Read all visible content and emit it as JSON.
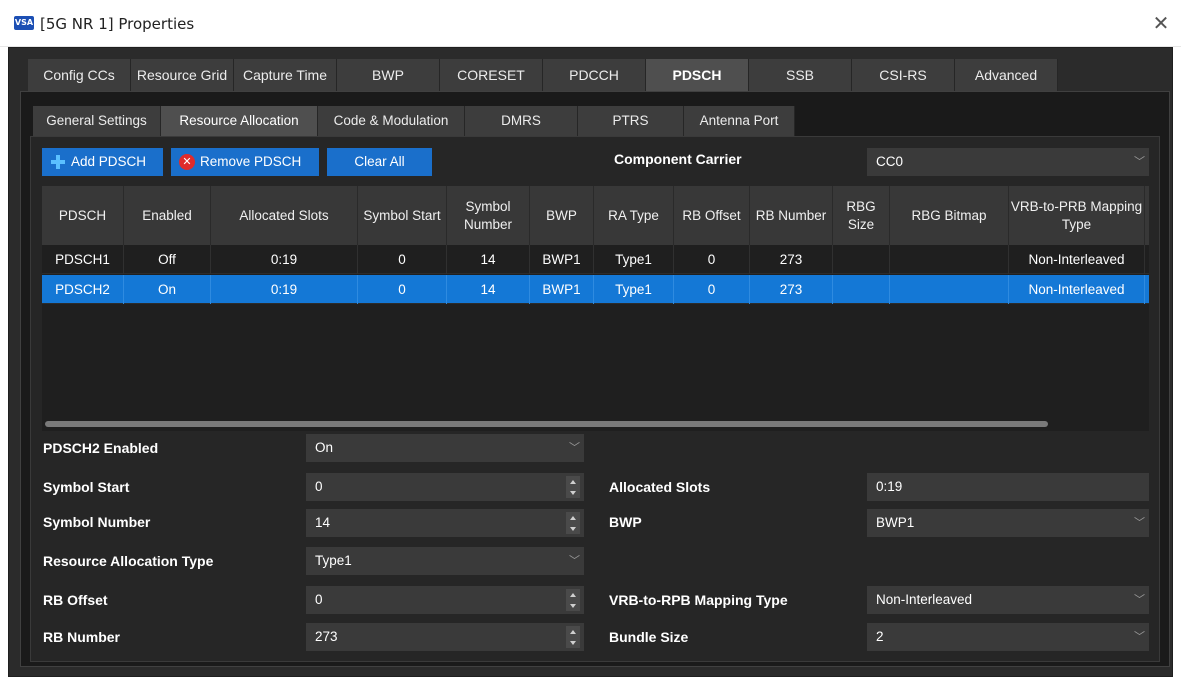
{
  "window": {
    "icon_text": "VSA",
    "title": "[5G NR 1] Properties",
    "close_glyph": "✕"
  },
  "tabs1": [
    {
      "label": "Config CCs"
    },
    {
      "label": "Resource Grid"
    },
    {
      "label": "Capture Time"
    },
    {
      "label": "BWP"
    },
    {
      "label": "CORESET"
    },
    {
      "label": "PDCCH"
    },
    {
      "label": "PDSCH"
    },
    {
      "label": "SSB"
    },
    {
      "label": "CSI-RS"
    },
    {
      "label": "Advanced"
    }
  ],
  "tabs2": [
    {
      "label": "General Settings"
    },
    {
      "label": "Resource Allocation"
    },
    {
      "label": "Code & Modulation"
    },
    {
      "label": "DMRS"
    },
    {
      "label": "PTRS"
    },
    {
      "label": "Antenna Port"
    }
  ],
  "toolbar": {
    "add_label": "Add PDSCH",
    "remove_label": "Remove PDSCH",
    "clear_label": "Clear All",
    "cc_label": "Component Carrier",
    "cc_value": "CC0"
  },
  "table": {
    "headers": [
      "PDSCH",
      "Enabled",
      "Allocated Slots",
      "Symbol Start",
      "Symbol Number",
      "BWP",
      "RA Type",
      "RB Offset",
      "RB Number",
      "RBG Size",
      "RBG Bitmap",
      "VRB-to-PRB Mapping Type"
    ],
    "rows": [
      {
        "cells": [
          "PDSCH1",
          "Off",
          "0:19",
          "0",
          "14",
          "BWP1",
          "Type1",
          "0",
          "273",
          "",
          "",
          "Non-Interleaved"
        ],
        "selected": false
      },
      {
        "cells": [
          "PDSCH2",
          "On",
          "0:19",
          "0",
          "14",
          "BWP1",
          "Type1",
          "0",
          "273",
          "",
          "",
          "Non-Interleaved"
        ],
        "selected": true
      }
    ]
  },
  "form_left": [
    {
      "label": "PDSCH2 Enabled",
      "value": "On",
      "kind": "select"
    },
    {
      "label": "Symbol Start",
      "value": "0",
      "kind": "spin"
    },
    {
      "label": "Symbol Number",
      "value": "14",
      "kind": "spin"
    },
    {
      "label": "Resource Allocation Type",
      "value": "Type1",
      "kind": "select"
    },
    {
      "label": "RB Offset",
      "value": "0",
      "kind": "spin"
    },
    {
      "label": "RB Number",
      "value": "273",
      "kind": "spin"
    }
  ],
  "form_right": [
    {
      "label": "Allocated Slots",
      "value": "0:19",
      "kind": "text"
    },
    {
      "label": "BWP",
      "value": "BWP1",
      "kind": "select"
    },
    {
      "label": "VRB-to-RPB Mapping Type",
      "value": "Non-Interleaved",
      "kind": "select"
    },
    {
      "label": "Bundle Size",
      "value": "2",
      "kind": "select"
    }
  ],
  "colors": {
    "accent": "#1a6fcb",
    "selected_row": "#1478d6",
    "panel": "#262626"
  }
}
